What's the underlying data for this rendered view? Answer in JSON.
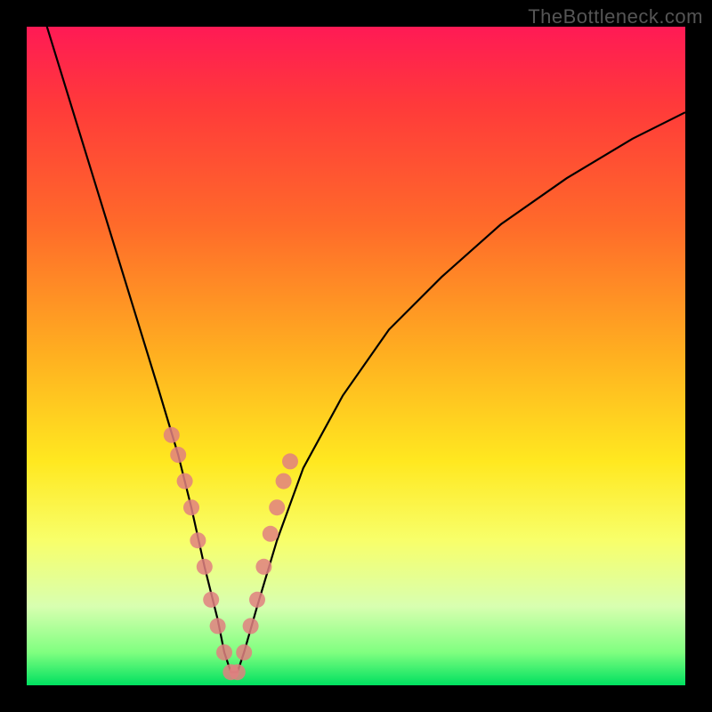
{
  "watermark": "TheBottleneck.com",
  "chart_data": {
    "type": "line",
    "title": "",
    "xlabel": "",
    "ylabel": "",
    "xlim": [
      0,
      100
    ],
    "ylim": [
      0,
      100
    ],
    "series": [
      {
        "name": "bottleneck-curve",
        "x": [
          0,
          4,
          8,
          12,
          16,
          20,
          23,
          25,
          27,
          29,
          30,
          31,
          32,
          33,
          35,
          38,
          42,
          48,
          55,
          63,
          72,
          82,
          92,
          100
        ],
        "values": [
          110,
          97,
          84,
          71,
          58,
          45,
          35,
          27,
          18,
          10,
          5,
          2,
          2,
          5,
          12,
          22,
          33,
          44,
          54,
          62,
          70,
          77,
          83,
          87
        ]
      }
    ],
    "markers": {
      "name": "highlight-dots",
      "color": "#e08080",
      "x": [
        22,
        23,
        24,
        25,
        26,
        27,
        28,
        29,
        30,
        31,
        32,
        33,
        34,
        35,
        36,
        37,
        38,
        39,
        40
      ],
      "values": [
        38,
        35,
        31,
        27,
        22,
        18,
        13,
        9,
        5,
        2,
        2,
        5,
        9,
        13,
        18,
        23,
        27,
        31,
        34
      ]
    }
  }
}
